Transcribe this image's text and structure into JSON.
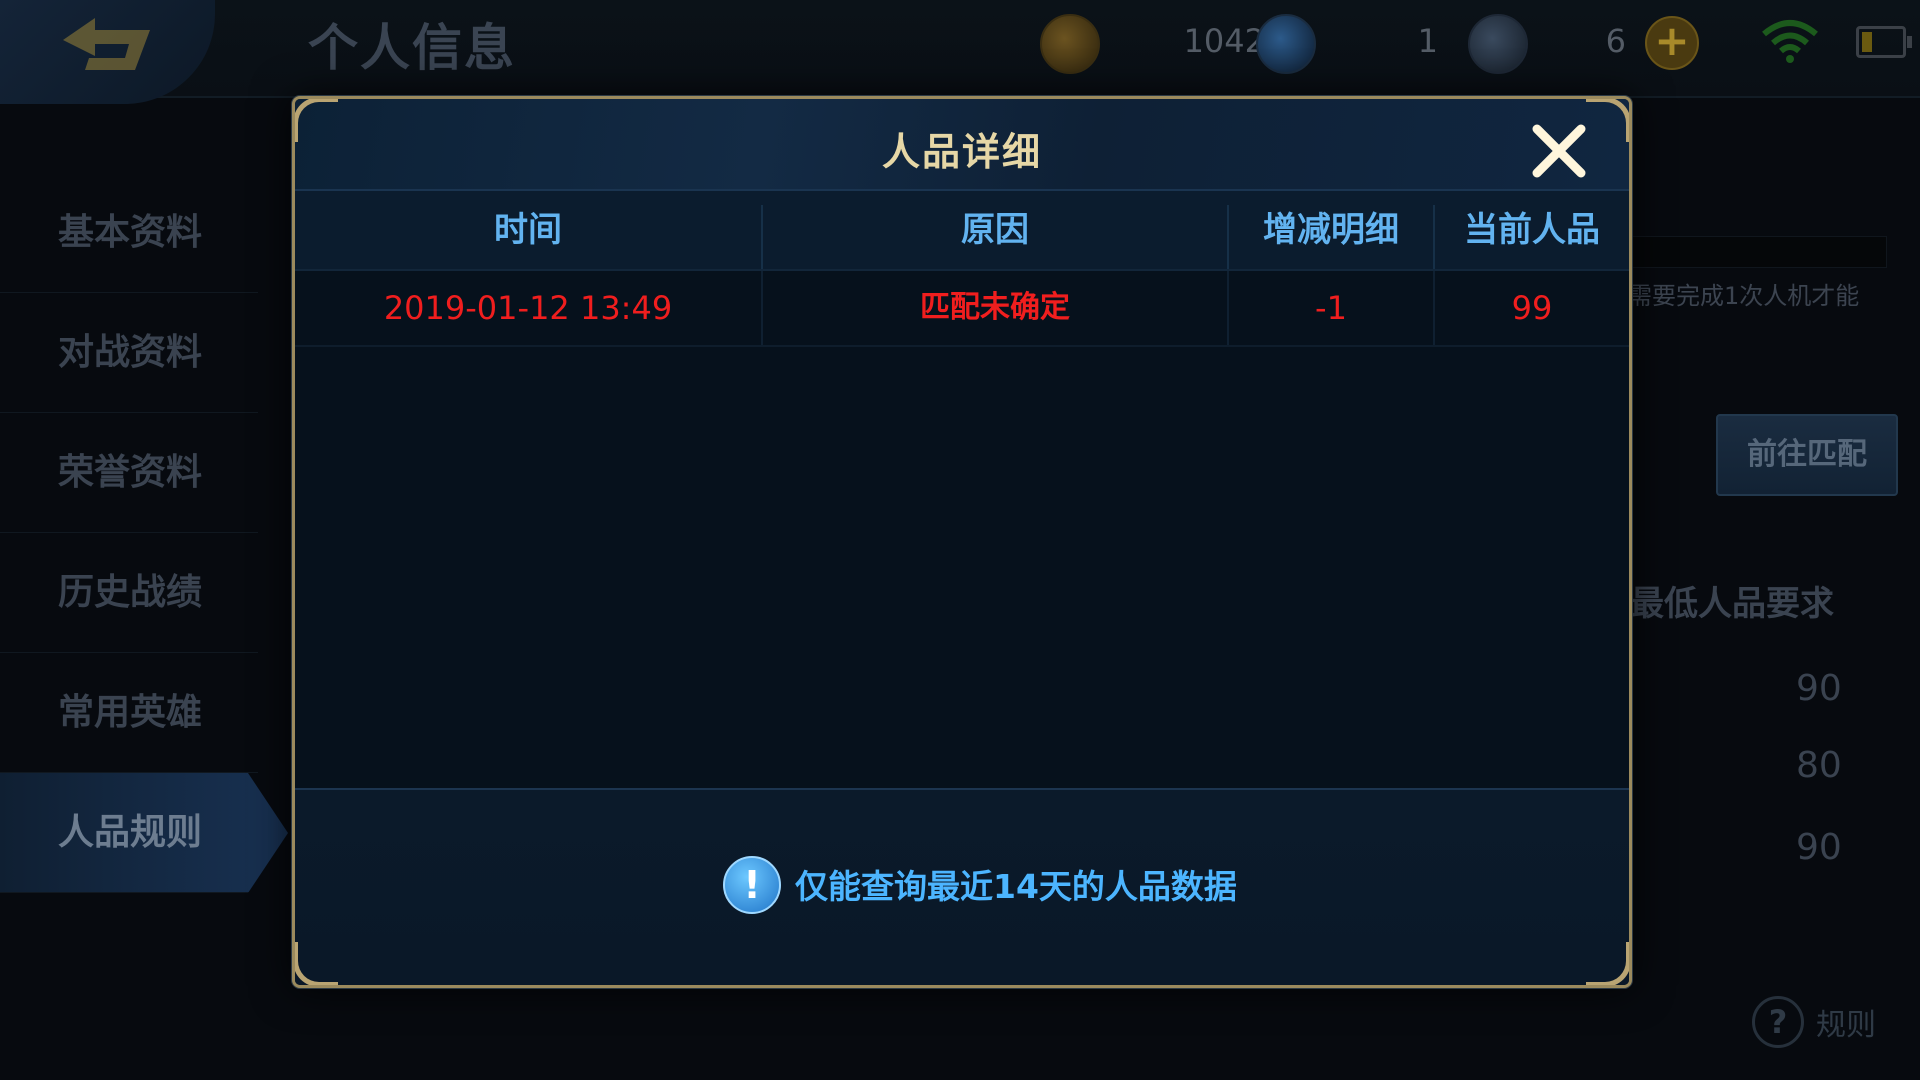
{
  "header": {
    "page_title": "个人信息",
    "currencies": [
      {
        "name": "gold-coin-icon",
        "value": "1042"
      },
      {
        "name": "diamond-icon",
        "value": "1"
      },
      {
        "name": "crystal-icon",
        "value": "6"
      }
    ],
    "plus_label": "+"
  },
  "sidebar": {
    "items": [
      {
        "label": "基本资料"
      },
      {
        "label": "对战资料"
      },
      {
        "label": "荣誉资料"
      },
      {
        "label": "历史战绩"
      },
      {
        "label": "常用英雄"
      },
      {
        "label": "人品规则",
        "active": true
      }
    ]
  },
  "background_panel": {
    "note": "需要完成1次人机才能",
    "goto_match_button": "前往匹配",
    "min_requirement_heading": "最低人品要求",
    "values": [
      "90",
      "80",
      "90"
    ],
    "rules_link": "规则",
    "rules_icon": "?"
  },
  "modal": {
    "title": "人品详细",
    "close_icon": "close-icon",
    "columns": [
      "时间",
      "原因",
      "增减明细",
      "当前人品"
    ],
    "rows": [
      {
        "time": "2019-01-12 13:49",
        "reason": "匹配未确定",
        "change": "-1",
        "current": "99"
      }
    ],
    "notice": "仅能查询最近14天的人品数据",
    "notice_icon": "!",
    "row_color": "#f01e1e",
    "header_color": "#62b3f0",
    "title_color": "#e6d7a6"
  }
}
